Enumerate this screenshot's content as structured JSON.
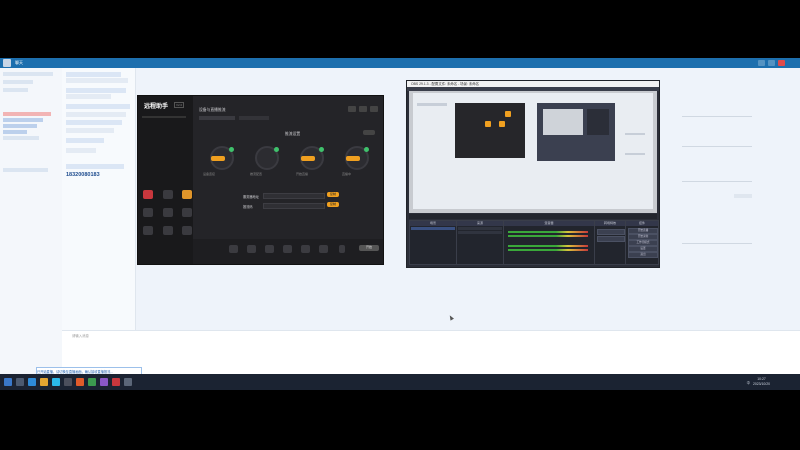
{
  "chat": {
    "window_title": "聊天",
    "phone_number": "18320080183",
    "input_placeholder": "请输入消息",
    "notification": "已开始直播，请切换至直播画面，确认接收直播推流..."
  },
  "app1": {
    "logo": "远程助手",
    "version": "V2.0",
    "section_title": "设备与直播推流",
    "panel_title": "推流设置",
    "field1_label": "服务器地址",
    "field2_label": "推流码",
    "copy_label": "复制",
    "start_label": "开始",
    "steps": [
      "设备连接",
      "推流配置",
      "开始直播",
      "直播中"
    ]
  },
  "obs": {
    "title": "OBS 29.1.3 - 配置文件: 未命名 - 场景: 未命名",
    "dock_scenes": "场景",
    "dock_sources": "来源",
    "dock_mixer": "混音器",
    "dock_transitions": "转场特效",
    "dock_controls": "控件",
    "controls": [
      "开始直播",
      "开始录制",
      "工作室模式",
      "设置",
      "退出"
    ]
  },
  "taskbar": {
    "tray_label": "中",
    "time": "10:27",
    "date": "2023/10/20"
  }
}
